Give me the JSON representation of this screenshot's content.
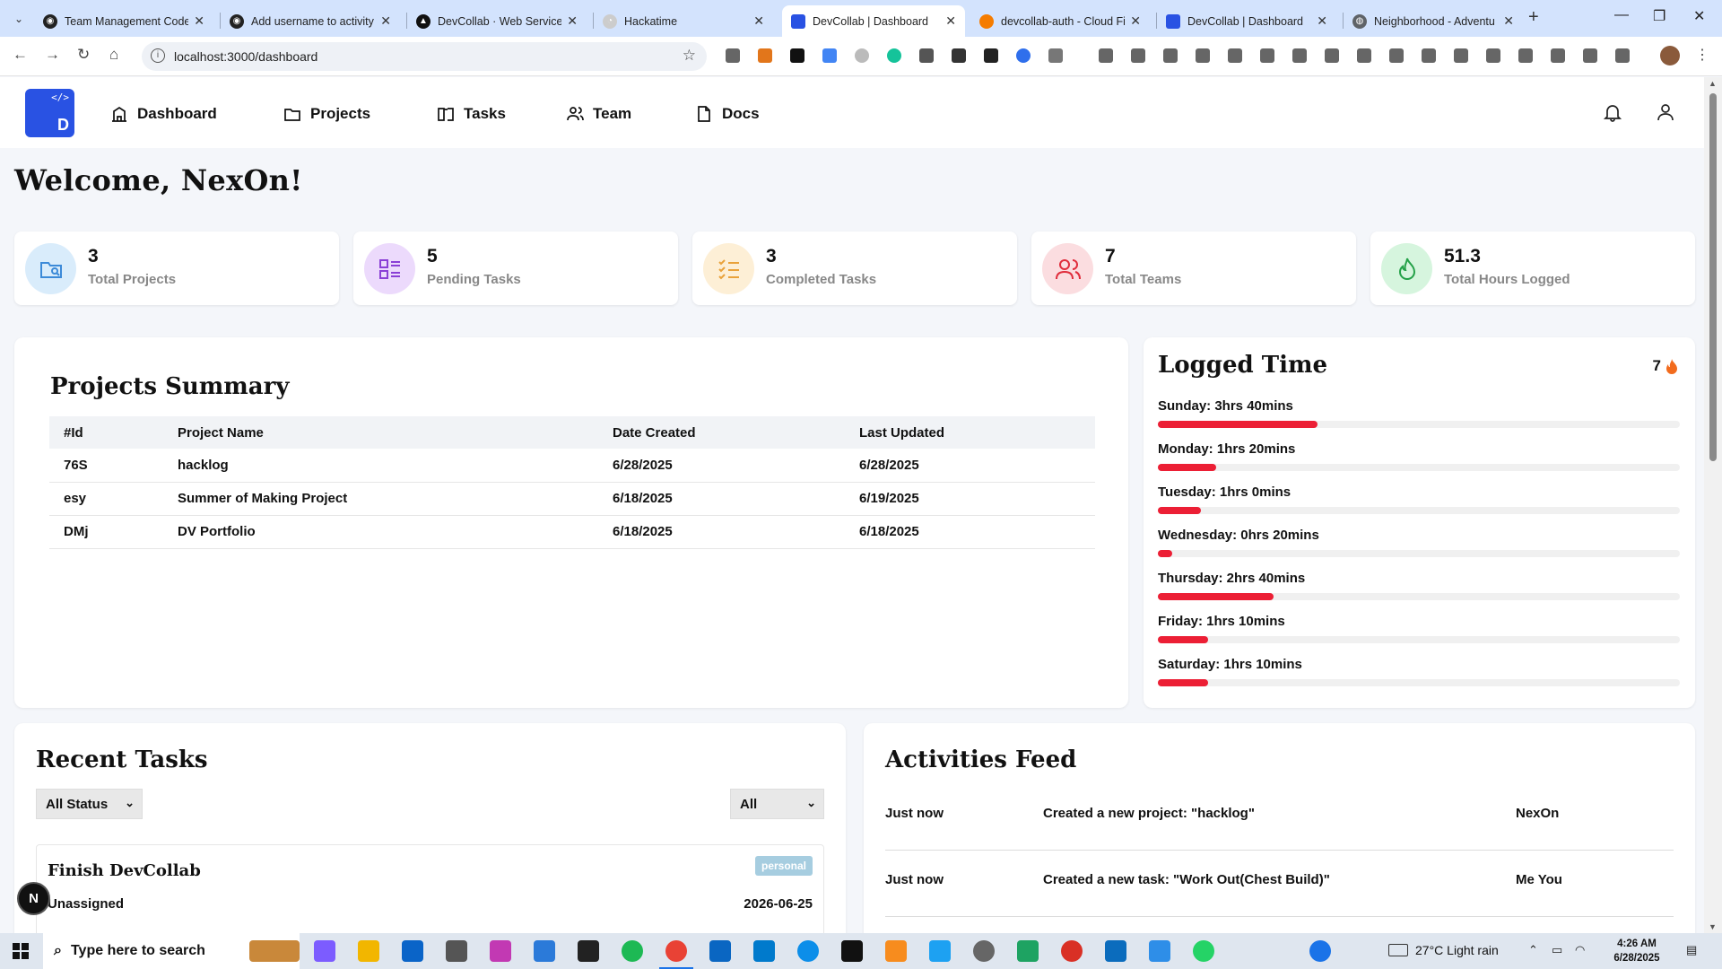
{
  "browser": {
    "tabs": [
      {
        "title": "Team Management Code",
        "favicon": "github-icon",
        "color": "#222222"
      },
      {
        "title": "Add username to activity",
        "favicon": "github-icon",
        "color": "#222222"
      },
      {
        "title": "DevCollab · Web Service",
        "favicon": "render-icon",
        "color": "#111111"
      },
      {
        "title": "Hackatime",
        "favicon": "hackatime-icon",
        "color": "#cccccc"
      },
      {
        "title": "DevCollab | Dashboard",
        "favicon": "devcollab-icon",
        "color": "#2952e3"
      },
      {
        "title": "devcollab-auth - Cloud Fi",
        "favicon": "firebase-icon",
        "color": "#f57c00"
      },
      {
        "title": "DevCollab | Dashboard",
        "favicon": "devcollab-icon",
        "color": "#2952e3"
      },
      {
        "title": "Neighborhood - Adventu",
        "favicon": "globe-icon",
        "color": "#5f6368"
      }
    ],
    "url": "localhost:3000/dashboard"
  },
  "nav": {
    "logo_code": "</>",
    "logo_letter": "D",
    "links": [
      "Dashboard",
      "Projects",
      "Tasks",
      "Team",
      "Docs"
    ]
  },
  "welcome": "Welcome, NexOn!",
  "stats": [
    {
      "value": "3",
      "label": "Total Projects",
      "icon": "folder-icon",
      "bg": "#d9ecfb",
      "fg": "#3c8ad8"
    },
    {
      "value": "5",
      "label": "Pending Tasks",
      "icon": "list-icon",
      "bg": "#ecdafc",
      "fg": "#8a3fd6"
    },
    {
      "value": "3",
      "label": "Completed Tasks",
      "icon": "checklist-icon",
      "bg": "#fdefd6",
      "fg": "#e9a23a"
    },
    {
      "value": "7",
      "label": "Total Teams",
      "icon": "users-icon",
      "bg": "#fbdde0",
      "fg": "#e02d3c"
    },
    {
      "value": "51.3",
      "label": "Total Hours Logged",
      "icon": "flame-icon",
      "bg": "#d6f5de",
      "fg": "#24a148"
    }
  ],
  "projects": {
    "title": "Projects Summary",
    "columns": [
      "#Id",
      "Project Name",
      "Date Created",
      "Last Updated"
    ],
    "rows": [
      [
        "76S",
        "hacklog",
        "6/28/2025",
        "6/28/2025"
      ],
      [
        "esy",
        "Summer of Making Project",
        "6/18/2025",
        "6/19/2025"
      ],
      [
        "DMj",
        "DV Portfolio",
        "6/18/2025",
        "6/18/2025"
      ]
    ]
  },
  "logged_time": {
    "title": "Logged Time",
    "streak": "7",
    "days": [
      {
        "label": "Sunday: 3hrs 40mins",
        "fraction": 0.306
      },
      {
        "label": "Monday: 1hrs 20mins",
        "fraction": 0.111
      },
      {
        "label": "Tuesday: 1hrs 0mins",
        "fraction": 0.083
      },
      {
        "label": "Wednesday: 0hrs 20mins",
        "fraction": 0.028
      },
      {
        "label": "Thursday: 2hrs 40mins",
        "fraction": 0.222
      },
      {
        "label": "Friday: 1hrs 10mins",
        "fraction": 0.097
      },
      {
        "label": "Saturday: 1hrs 10mins",
        "fraction": 0.097
      }
    ]
  },
  "recent_tasks": {
    "title": "Recent Tasks",
    "status_filter": "All Status",
    "type_filter": "All",
    "items": [
      {
        "name": "Finish DevCollab",
        "badge": "personal",
        "assignee": "Unassigned",
        "date": "2026-06-25"
      }
    ]
  },
  "activities": {
    "title": "Activities Feed",
    "items": [
      {
        "time": "Just now",
        "text": "Created a new project: \"hacklog\"",
        "user": "NexOn"
      },
      {
        "time": "Just now",
        "text": "Created a new task: \"Work Out(Chest Build)\"",
        "user": "Me You"
      }
    ]
  },
  "next_badge": "N",
  "taskbar": {
    "search_placeholder": "Type here to search",
    "weather": "27°C  Light rain",
    "time": "4:26 AM",
    "date": "6/28/2025"
  }
}
